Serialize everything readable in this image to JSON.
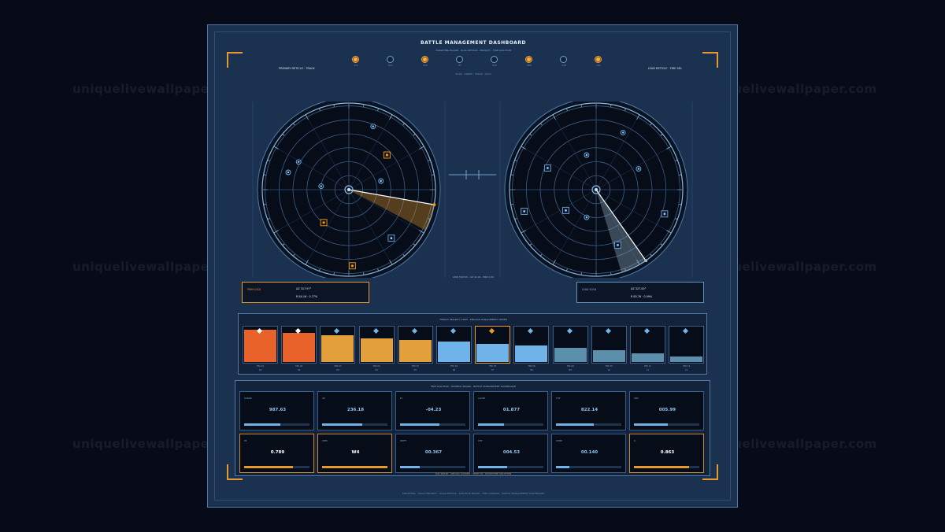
{
  "header": {
    "title": "BATTLE MANAGEMENT DASHBOARD",
    "subtitle": "TARGETING BOARD · DUAL RETICLE · PRIORITY · FIRE SOLUTION",
    "scope_hint": "SCAN · SWEEP · TRACK · LOCK",
    "primary_label": "PRIMARY RETICLE · TRACK",
    "lead_label": "LEAD RETICLE · FIRE SEL"
  },
  "status_indicators": [
    {
      "label": "SYS",
      "on": true
    },
    {
      "label": "NAV",
      "on": false
    },
    {
      "label": "RDR",
      "on": true
    },
    {
      "label": "IFF",
      "on": false
    },
    {
      "label": "ECM",
      "on": false
    },
    {
      "label": "WPN",
      "on": true
    },
    {
      "label": "COM",
      "on": false
    },
    {
      "label": "LNK",
      "on": true
    }
  ],
  "radars": {
    "left": {
      "sweep_deg": 10,
      "sweep_color": "#e69a2c"
    },
    "right": {
      "sweep_deg": 55,
      "sweep_color": "#9fb7cf"
    },
    "top_tick": "000",
    "bottom_tick": "180"
  },
  "readout": "LINK STATUS · AZ 41.00 · ERR 0.99",
  "primary_lock": {
    "key": "PRIM LOCK",
    "v1": "AZ 317.97°",
    "v2": "R 84.16 · 0.77%"
  },
  "lead_lock": {
    "key": "LEAD SOLN",
    "v1": "AZ 327.00°",
    "v2": "R 85.76 · 0.99%"
  },
  "priority_strip": {
    "title": "THREAT PRIORITY STRIP · ENGAGE MANAGEMENT ORDER",
    "tracks": [
      {
        "level": 0.93,
        "color": "#e8622a",
        "label": "TRK 01",
        "sub": "01",
        "selected": false
      },
      {
        "level": 0.85,
        "color": "#e8622a",
        "label": "TRK 02",
        "sub": "02",
        "selected": false
      },
      {
        "level": 0.78,
        "color": "#e3a03a",
        "label": "TRK 03",
        "sub": "03",
        "selected": false
      },
      {
        "level": 0.68,
        "color": "#e3a03a",
        "label": "TRK 04",
        "sub": "04",
        "selected": false
      },
      {
        "level": 0.63,
        "color": "#e3a03a",
        "label": "TRK 05",
        "sub": "05",
        "selected": false
      },
      {
        "level": 0.58,
        "color": "#6fb3e8",
        "label": "TRK 06",
        "sub": "06",
        "selected": false
      },
      {
        "level": 0.52,
        "color": "#6fb3e8",
        "label": "TRK 07",
        "sub": "07",
        "selected": true
      },
      {
        "level": 0.48,
        "color": "#6fb3e8",
        "label": "TRK 08",
        "sub": "08",
        "selected": false
      },
      {
        "level": 0.4,
        "color": "#5b8fab",
        "label": "TRK 09",
        "sub": "09",
        "selected": false
      },
      {
        "level": 0.33,
        "color": "#5b8fab",
        "label": "TRK 10",
        "sub": "10",
        "selected": false
      },
      {
        "level": 0.26,
        "color": "#5b8fab",
        "label": "TRK 11",
        "sub": "11",
        "selected": false
      },
      {
        "level": 0.17,
        "color": "#5b8fab",
        "label": "TRK 12",
        "sub": "12",
        "selected": false
      }
    ]
  },
  "fire_solution": {
    "title": "FIRE SOLUTION · NUMERIC BOARD · BATTLE MANAGEMENT DASHBOARD",
    "footer": "SOL READY · RECALL LOCKED · TRUE TO · ZOOM FIRE SOLUTION",
    "cards": [
      {
        "key": "RANGE",
        "value": "987.63",
        "level": 0.55,
        "amber": false
      },
      {
        "key": "AZ",
        "value": "236.18",
        "level": 0.62,
        "amber": false
      },
      {
        "key": "EL",
        "value": "-04.23",
        "level": 0.6,
        "amber": false
      },
      {
        "key": "CLOSE",
        "value": "01.877",
        "level": 0.4,
        "amber": false
      },
      {
        "key": "TOF",
        "value": "822.14",
        "level": 0.58,
        "amber": false
      },
      {
        "key": "SPD",
        "value": "005.99",
        "level": 0.52,
        "amber": false
      },
      {
        "key": "PK",
        "value": "0.789",
        "level": 0.75,
        "amber": true
      },
      {
        "key": "WPN",
        "value": "W4",
        "level": 1.0,
        "amber": true
      },
      {
        "key": "DRIFT",
        "value": "00.367",
        "level": 0.3,
        "amber": false
      },
      {
        "key": "CEP",
        "value": "004.53",
        "level": 0.45,
        "amber": false
      },
      {
        "key": "WIND",
        "value": "00.140",
        "level": 0.2,
        "amber": false
      },
      {
        "key": "Q",
        "value": "0.863",
        "level": 0.84,
        "amber": true
      }
    ]
  },
  "footer": "TARGETING · TRACK PRIORITY · DUAL RETICLE · SOLUTION BOARD · FIRE CONTROL · BATTLE MANAGEMENT DASHBOARD",
  "watermark": "uniquelivewallpaper.com",
  "colors": {
    "accent": "#e69a2c",
    "cyan": "#6fb3e8",
    "panel": "#1b3150"
  }
}
